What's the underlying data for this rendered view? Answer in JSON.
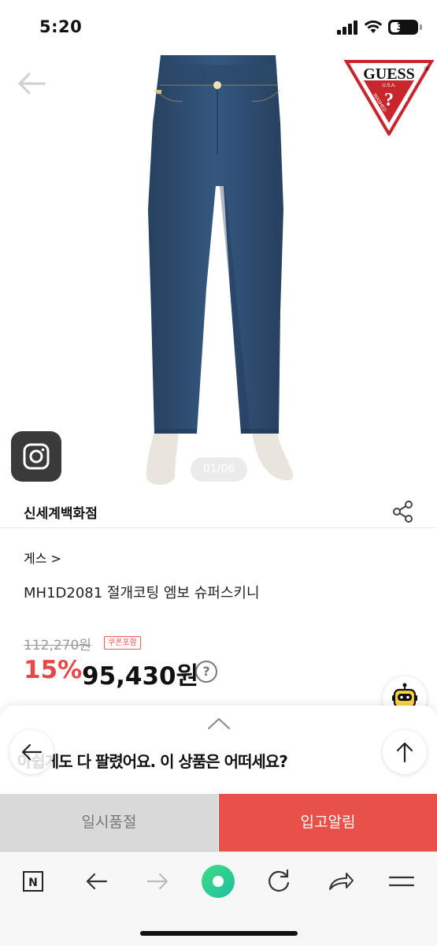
{
  "status_bar": {
    "time": "5:20",
    "battery": "37",
    "battery_level": 0.37
  },
  "product": {
    "image_counter": "01/06",
    "store_name": "신세계백화점",
    "brand_link": "게스 >",
    "title": "MH1D2081 절개코팅 엠보 슈퍼스키니",
    "original_price": "112,270원",
    "coupon_badge": "쿠폰포함",
    "discount_rate": "15%",
    "sale_price": "95,430원",
    "help_icon": "?"
  },
  "logo": {
    "brand": "GUESS",
    "registered": "®",
    "sub": "U.S.A.",
    "mark": "?",
    "left_text": "WASHED",
    "right_text": "JEANS"
  },
  "bottom_sheet": {
    "message": "아쉽게도 다 팔렸어요. 이 상품은 어떠세요?"
  },
  "actions": {
    "soldout_label": "일시품절",
    "restock_label": "입고알림"
  },
  "toolbar": {
    "n_label": "N"
  },
  "colors": {
    "accent": "#e8504a",
    "discount": "#e64848",
    "soldout_bg": "#d9d9d9",
    "denim": "#2f4c72"
  },
  "icons": [
    "back-arrow-icon",
    "instagram-icon",
    "share-icon",
    "help-icon",
    "chatbot-icon",
    "arrow-left-icon",
    "arrow-up-icon",
    "n-home-icon",
    "arrow-right-icon",
    "green-circle-icon",
    "refresh-icon",
    "forward-share-icon",
    "menu-icon"
  ]
}
